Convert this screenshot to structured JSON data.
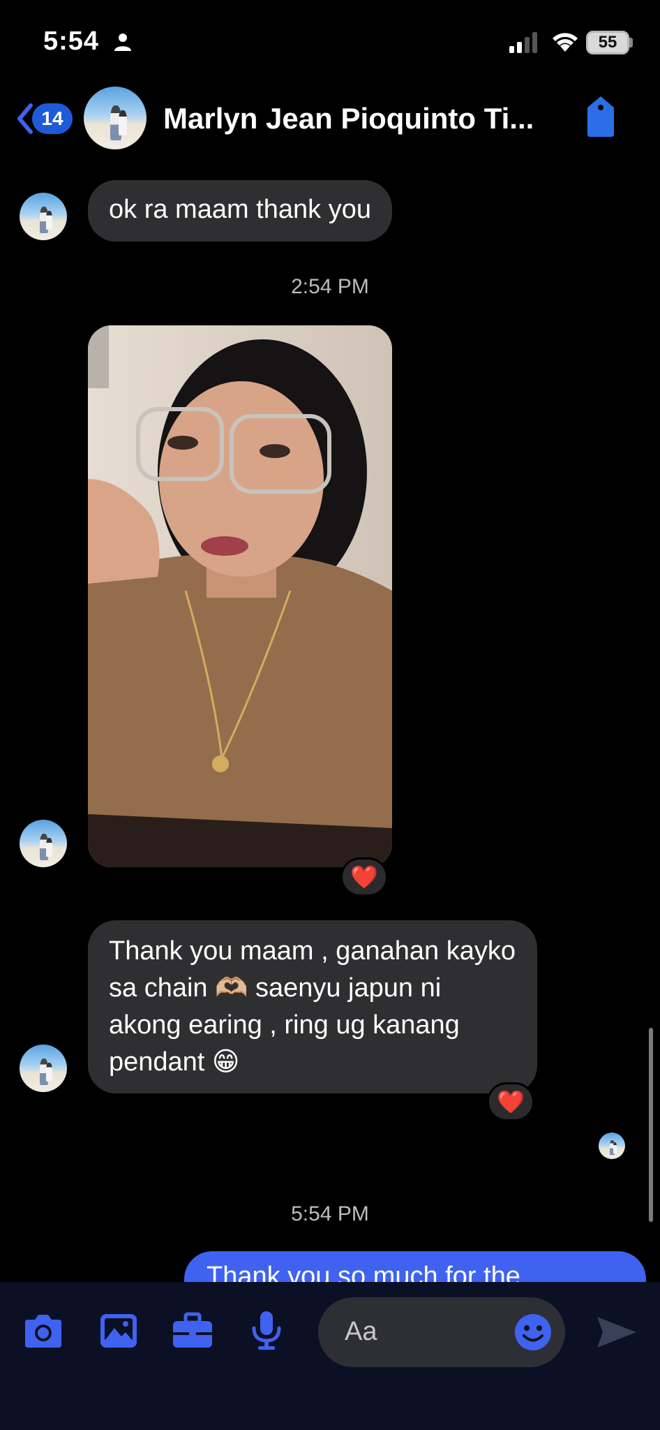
{
  "status_bar": {
    "time": "5:54",
    "battery": "55"
  },
  "header": {
    "unread_count": "14",
    "contact_name": "Marlyn Jean Pioquinto Ti..."
  },
  "messages": [
    {
      "type": "text_in",
      "text": "ok ra maam thank you"
    },
    {
      "type": "timestamp",
      "text": "2:54 PM"
    },
    {
      "type": "photo_in",
      "reaction": "❤️"
    },
    {
      "type": "text_in",
      "text": "Thank you maam , ganahan kayko sa chain 🫶🏼 saenyu japun ni akong earing , ring ug kanang pendant 😁",
      "reaction": "❤️"
    },
    {
      "type": "timestamp",
      "text": "5:54 PM"
    },
    {
      "type": "text_out",
      "text": "Thank you so much for the"
    }
  ],
  "composer": {
    "placeholder": "Aa",
    "icons": [
      "camera-icon",
      "image-icon",
      "briefcase-icon",
      "microphone-icon",
      "smiley-icon",
      "send-icon"
    ]
  },
  "colors": {
    "accent": "#3f63f0",
    "incoming_bubble": "#2f2f31",
    "background": "#000000"
  }
}
